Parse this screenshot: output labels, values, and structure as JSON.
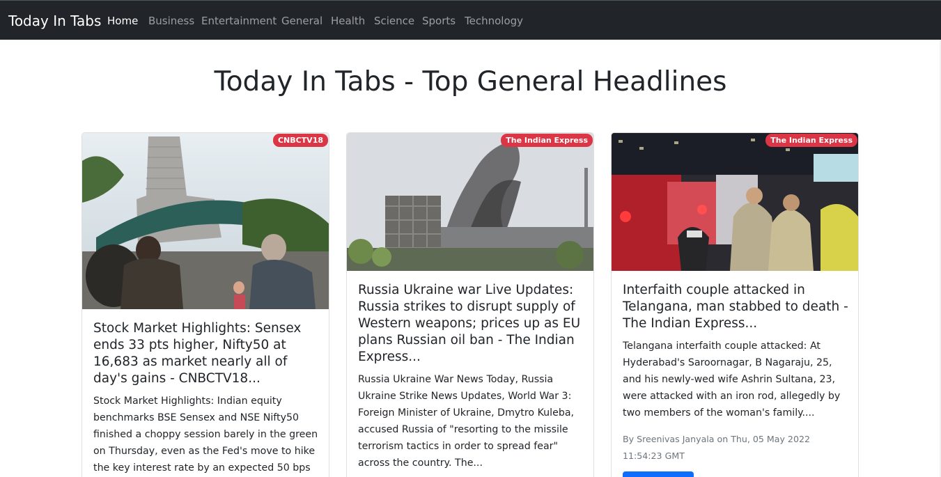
{
  "navbar": {
    "brand": "Today In Tabs",
    "links": [
      {
        "label": "Home",
        "active": true
      },
      {
        "label": "Business",
        "active": false
      },
      {
        "label": "Entertainment",
        "active": false
      },
      {
        "label": "General",
        "active": false
      },
      {
        "label": "Health",
        "active": false
      },
      {
        "label": "Science",
        "active": false
      },
      {
        "label": "Sports",
        "active": false
      },
      {
        "label": "Technology",
        "active": false
      }
    ]
  },
  "page": {
    "title": "Today In Tabs - Top General Headlines"
  },
  "articles": [
    {
      "source": "CNBCTV18",
      "image_icon": "stock-exchange-photo",
      "title": "Stock Market Highlights: Sensex ends 33 pts higher, Nifty50 at 16,683 as market nearly all of day's gains - CNBCTV18...",
      "description": "Stock Market Highlights: Indian equity benchmarks BSE Sensex and NSE Nifty50 finished a choppy session barely in the green on Thursday, even as the Fed's move to hike the key interest rate by an expected 50 bps",
      "meta": ""
    },
    {
      "source": "The Indian Express",
      "image_icon": "industrial-smoke-photo",
      "title": "Russia Ukraine war Live Updates: Russia strikes to disrupt supply of Western weapons; prices up as EU plans Russian oil ban - The Indian Express...",
      "description": "Russia Ukraine War News Today, Russia Ukraine Strike News Updates, World War 3: Foreign Minister of Ukraine, Dmytro Kuleba, accused Russia of \"resorting to the missile terrorism tactics in order to spread fear\" across the country. The...",
      "meta": ""
    },
    {
      "source": "The Indian Express",
      "image_icon": "night-street-crowd-photo",
      "title": "Interfaith couple attacked in Telangana, man stabbed to death - The Indian Express...",
      "description": "Telangana interfaith couple attacked: At Hyderabad's Saroornagar, B Nagaraju, 25, and his newly-wed wife Ashrin Sultana, 23, were attacked with an iron rod, allegedly by two members of the woman's family....",
      "meta": "By Sreenivas Janyala on Thu, 05 May 2022 11:54:23 GMT"
    }
  ]
}
